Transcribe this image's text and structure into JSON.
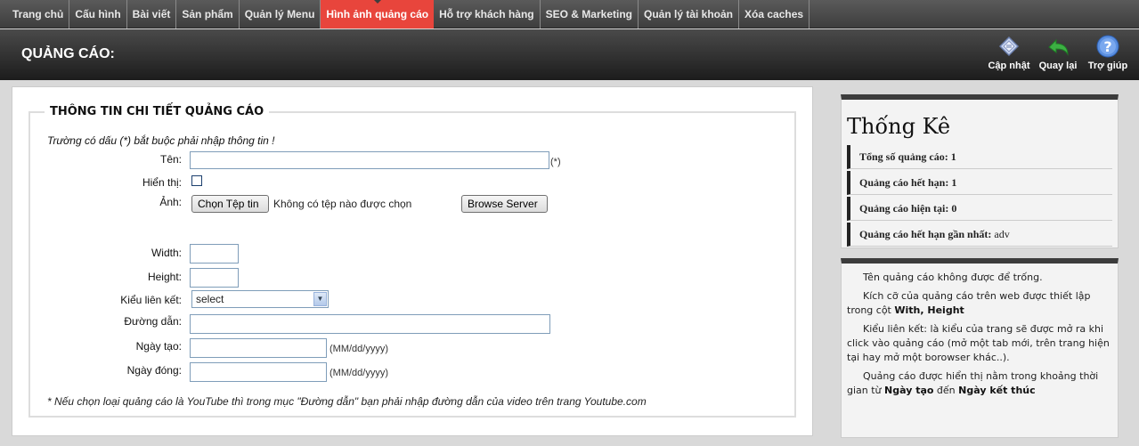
{
  "nav": {
    "items": [
      {
        "label": "Trang chủ",
        "active": false
      },
      {
        "label": "Cấu hình",
        "active": false
      },
      {
        "label": "Bài viết",
        "active": false
      },
      {
        "label": "Sản phẩm",
        "active": false
      },
      {
        "label": "Quản lý Menu",
        "active": false
      },
      {
        "label": "Hình ảnh quảng cáo",
        "active": true
      },
      {
        "label": "Hỗ trợ khách hàng",
        "active": false
      },
      {
        "label": "SEO & Marketing",
        "active": false
      },
      {
        "label": "Quản lý tài khoản",
        "active": false
      },
      {
        "label": "Xóa caches",
        "active": false
      }
    ]
  },
  "header": {
    "title": "QUẢNG CÁO:",
    "tools": {
      "update": "Cập nhật",
      "back": "Quay lại",
      "help": "Trợ giúp"
    }
  },
  "form": {
    "legend": "THÔNG TIN CHI TIẾT QUẢNG CÁO",
    "required_note": "Trường có dấu (*) bắt buộc phải nhập thông tin !",
    "name_label": "Tên:",
    "required_mark": "(*)",
    "name_value": "",
    "visible_label": "Hiển thị:",
    "image_label": "Ảnh:",
    "choose_file": "Chọn Tệp tin",
    "no_file": "Không có tệp nào được chọn",
    "browse_server": "Browse Server",
    "width_label": "Width:",
    "width_value": "",
    "height_label": "Height:",
    "height_value": "",
    "link_type_label": "Kiểu liên kết:",
    "link_type_value": "select",
    "path_label": "Đường dẫn:",
    "path_value": "",
    "created_label": "Ngày tạo:",
    "created_value": "",
    "created_format": "(MM/dd/yyyy)",
    "closed_label": "Ngày đóng:",
    "closed_value": "",
    "closed_format": "(MM/dd/yyyy)",
    "footnote": "* Nếu chọn loại quảng cáo là YouTube thì trong mục \"Đường dẫn\" bạn phải nhập đường dẫn của video trên trang Youtube.com"
  },
  "stats": {
    "title": "Thống Kê",
    "rows": [
      {
        "label": "Tổng số quảng cáo:",
        "value": "1"
      },
      {
        "label": "Quảng cáo hết hạn:",
        "value": "1"
      },
      {
        "label": "Quảng cáo hiện tại:",
        "value": "0"
      },
      {
        "label": "Quảng cáo hết hạn gần nhất:",
        "value": "adv"
      }
    ]
  },
  "help": {
    "p1": "Tên quảng cáo không được để trống.",
    "p2a": "Kích cỡ của quảng cáo trên web được thiết lập trong cột ",
    "p2b": "With, Height",
    "p3": "Kiểu liên kết: là kiểu của trang sẽ được mở ra khi click vào quảng cáo (mở một tab mới, trên trang hiện tại hay mở một borowser khác..).",
    "p4a": "Quảng cáo được hiển thị nằm trong khoảng thời gian từ ",
    "p4b": "Ngày tạo",
    "p4c": " đến ",
    "p4d": "Ngày kết thúc"
  },
  "colors": {
    "active_tab": "#e8453c",
    "header_bg": "#2a2a2a"
  }
}
